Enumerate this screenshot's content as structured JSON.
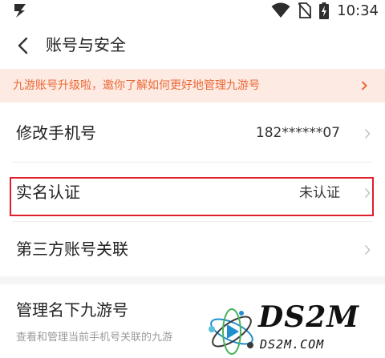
{
  "status_bar": {
    "time": "10:34",
    "icons": [
      "app-logo-icon",
      "wifi-icon",
      "no-sim-icon",
      "battery-charging-icon"
    ]
  },
  "header": {
    "title": "账号与安全",
    "back_icon": "back-arrow-icon"
  },
  "banner": {
    "text": "九游账号升级啦，邀你了解如何更好地管理九游号",
    "color": "#ea6a36",
    "background": "#fdeae3"
  },
  "settings": [
    {
      "label": "修改手机号",
      "value": "182******07"
    },
    {
      "label": "实名认证",
      "value": "未认证",
      "highlighted": true
    },
    {
      "label": "第三方账号关联",
      "value": ""
    }
  ],
  "manage_section": {
    "title": "管理名下九游号",
    "description": "查看和管理当前手机号关联的九游"
  },
  "watermark": {
    "brand": "DS2M",
    "domain": "DS2M.COM"
  },
  "colors": {
    "highlight_border": "#e21e2b",
    "chevron": "#c4c4c4"
  }
}
